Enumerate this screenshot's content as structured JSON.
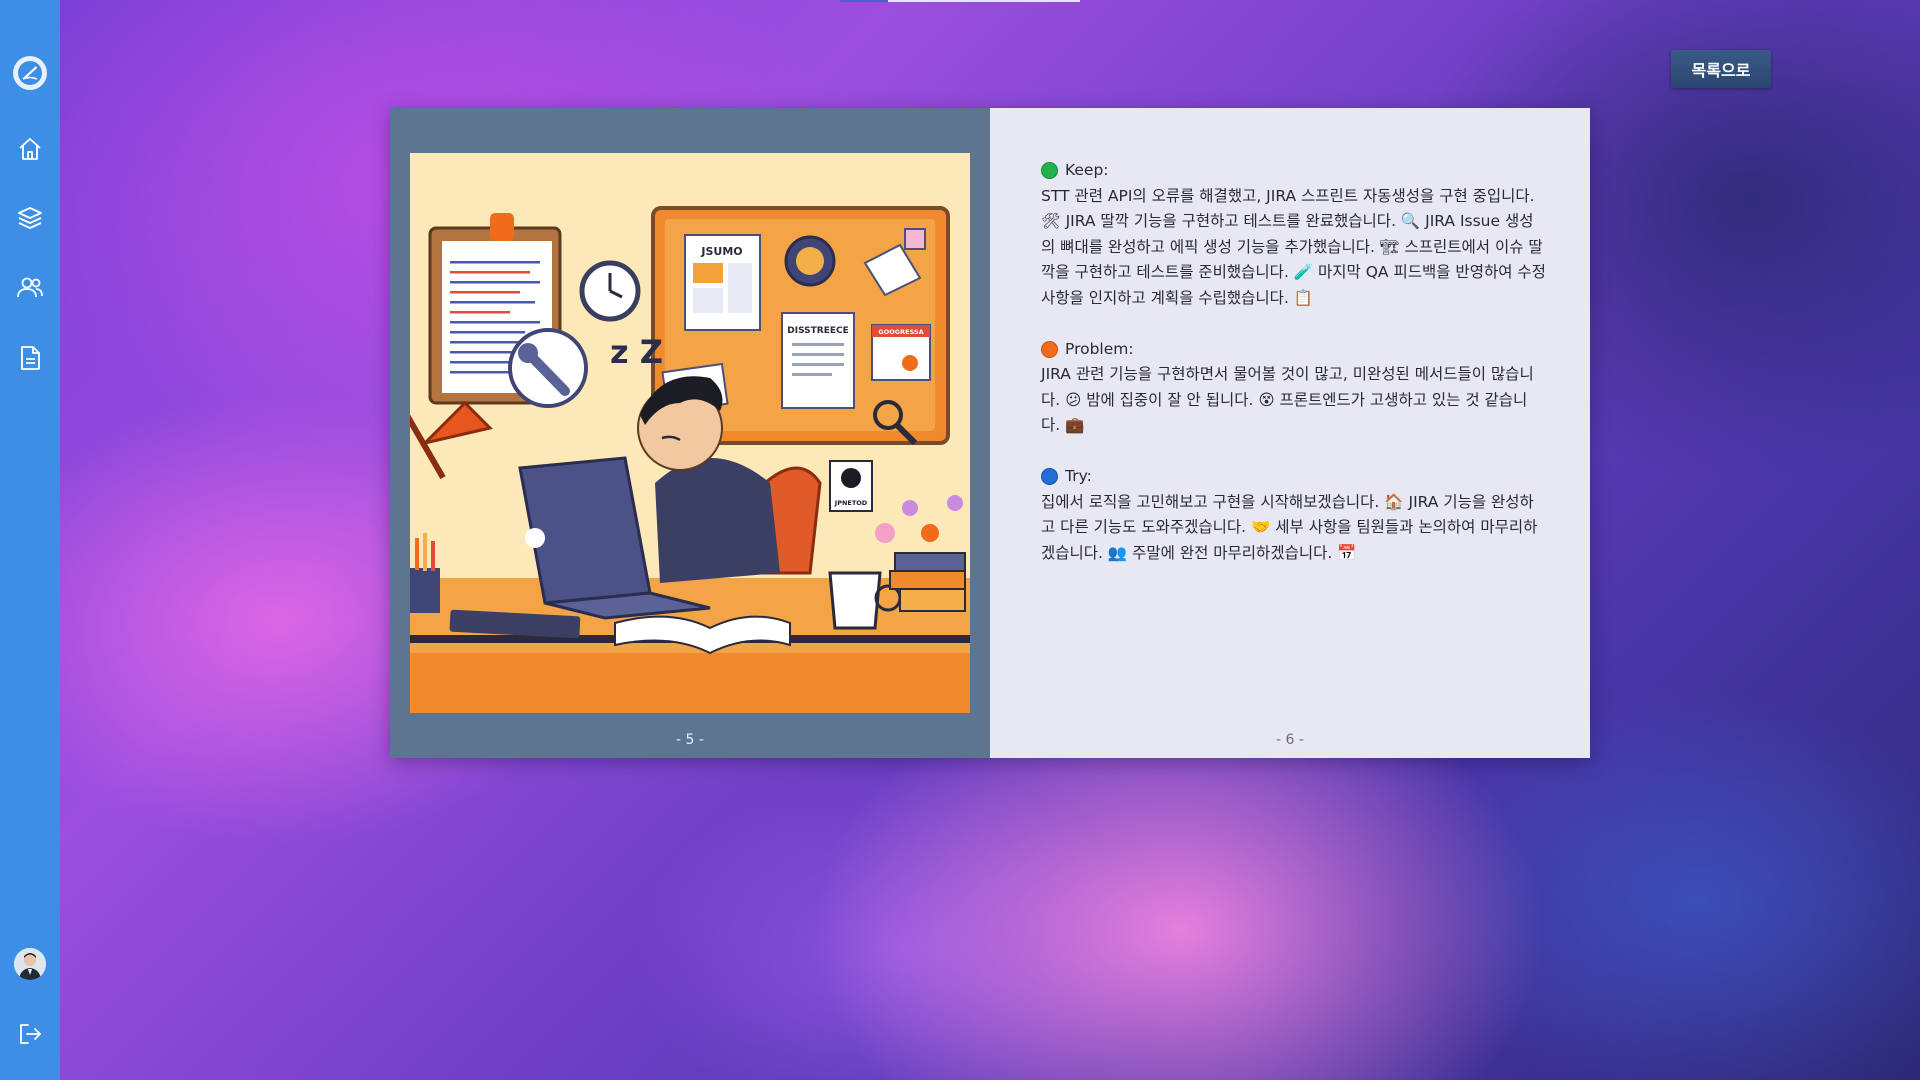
{
  "nav": {
    "items": [
      {
        "name": "home"
      },
      {
        "name": "layers"
      },
      {
        "name": "team"
      },
      {
        "name": "document"
      }
    ]
  },
  "header": {
    "back_label": "목록으로"
  },
  "book": {
    "left_page_number": "- 5 -",
    "right_page_number": "- 6 -",
    "illustration": {
      "board_labels": [
        "JSUMO",
        "DISSTREECE",
        "GOOGRESSA"
      ],
      "sticker_label": "JPNETOD"
    },
    "sections": [
      {
        "title": "Keep:",
        "color": "#22b14c",
        "text": "STT 관련 API의 오류를 해결했고, JIRA 스프린트 자동생성을 구현 중입니다. 🛠 JIRA 딸깍 기능을 구현하고 테스트를 완료했습니다. 🔍 JIRA Issue 생성의 뼈대를 완성하고 에픽 생성 기능을 추가했습니다. 🏗 스프린트에서 이슈 딸깍을 구현하고 테스트를 준비했습니다. 🧪 마지막 QA 피드백을 반영하여 수정사항을 인지하고 계획을 수립했습니다. 📋"
      },
      {
        "title": "Problem:",
        "color": "#f26b1d",
        "text": "JIRA 관련 기능을 구현하면서 물어볼 것이 많고, 미완성된 메서드들이 많습니다. 😕 밤에 집중이 잘 안 됩니다. 😵 프론트엔드가 고생하고 있는 것 같습니다. 💼"
      },
      {
        "title": "Try:",
        "color": "#1f6fd6",
        "text": "집에서 로직을 고민해보고 구현을 시작해보겠습니다. 🏠 JIRA 기능을 완성하고 다른 기능도 도와주겠습니다. 🤝 세부 사항을 팀원들과 논의하여 마무리하겠습니다. 👥 주말에 완전 마무리하겠습니다. 📅"
      }
    ]
  }
}
